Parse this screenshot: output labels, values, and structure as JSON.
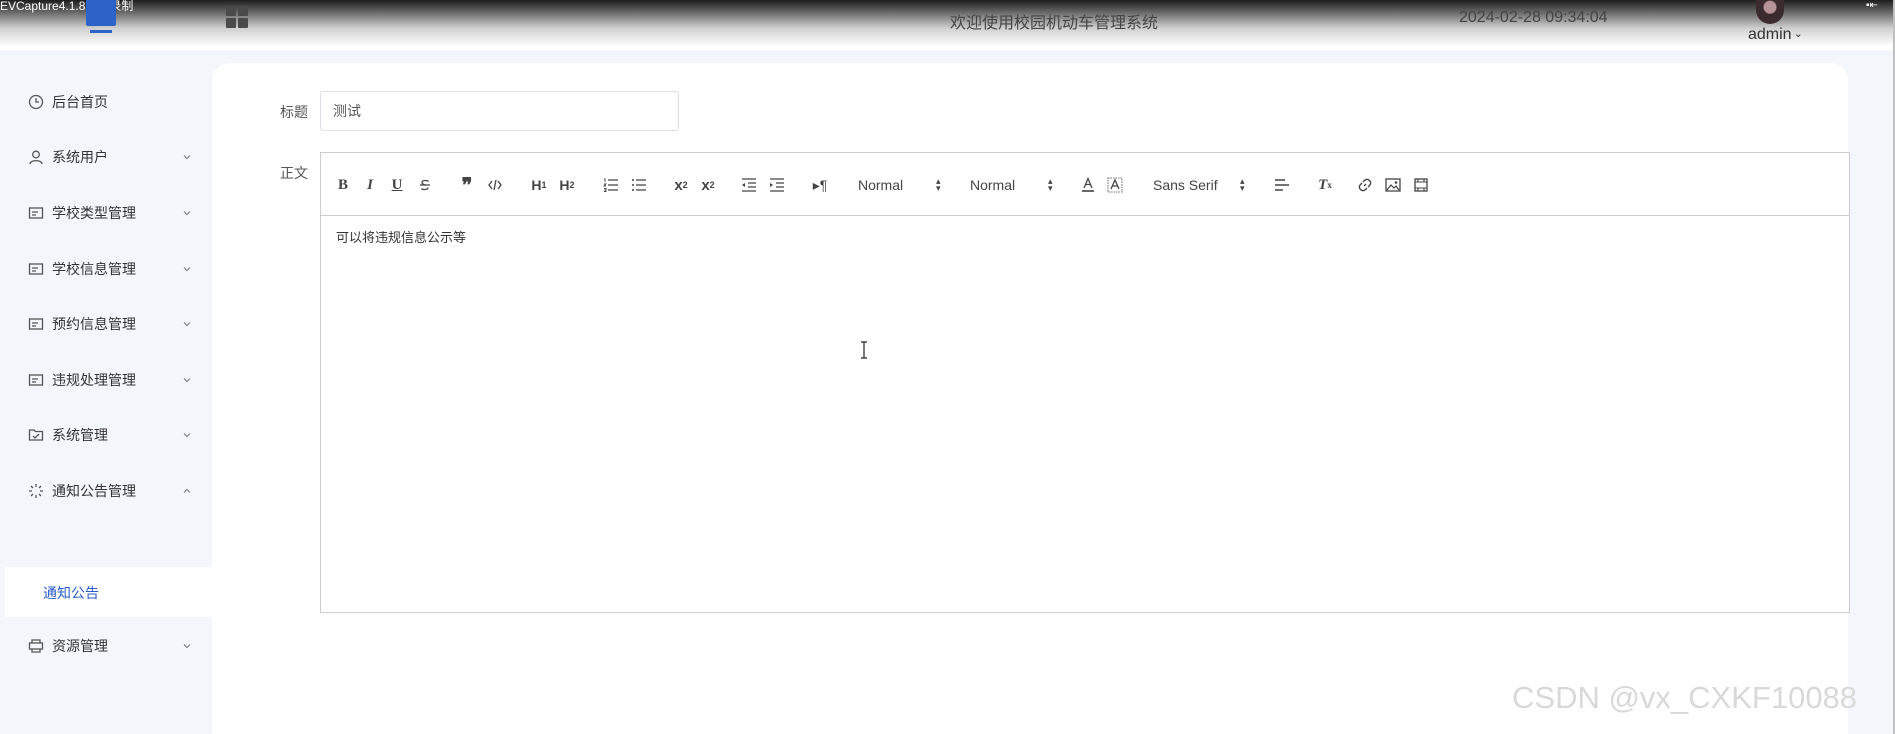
{
  "recorder_watermark": "EVCapture4.1.8软件录制",
  "header": {
    "title": "欢迎使用校园机动车管理系统",
    "datetime": "2024-02-28 09:34:04",
    "user": "admin"
  },
  "sidebar": {
    "items": [
      {
        "label": "后台首页",
        "icon": "clock-icon"
      },
      {
        "label": "系统用户",
        "icon": "user-icon"
      },
      {
        "label": "学校类型管理",
        "icon": "card-icon"
      },
      {
        "label": "学校信息管理",
        "icon": "card-icon"
      },
      {
        "label": "预约信息管理",
        "icon": "card-icon"
      },
      {
        "label": "违规处理管理",
        "icon": "card-icon"
      },
      {
        "label": "系统管理",
        "icon": "check-box-icon"
      },
      {
        "label": "通知公告管理",
        "icon": "loading-icon"
      },
      {
        "label": "资源管理",
        "icon": "printer-icon"
      }
    ],
    "subitem": {
      "label": "通知公告"
    }
  },
  "form": {
    "title_label": "标题",
    "title_value": "测试",
    "body_label": "正文",
    "body_text": "可以将违规信息公示等"
  },
  "toolbar": {
    "header_picker": "Normal",
    "size_picker": "Normal",
    "font_picker": "Sans Serif"
  },
  "footer_watermark": "CSDN @vx_CXKF10088",
  "colors": {
    "accent": "#2a5cc8",
    "sidebar_bg": "#f3f6fb",
    "panel_bg": "#ffffff"
  }
}
